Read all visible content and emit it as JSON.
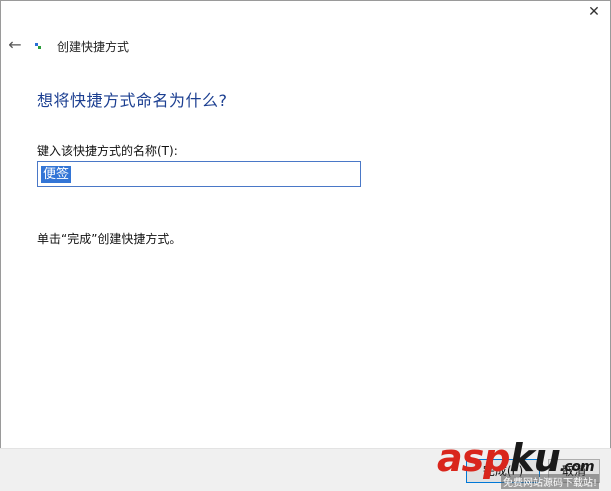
{
  "window": {
    "title": "创建快捷方式",
    "close_glyph": "✕",
    "back_glyph": "←"
  },
  "main": {
    "heading": "想将快捷方式命名为什么?",
    "field_label": "键入该快捷方式的名称(T):",
    "name_value": "便签",
    "hint": "单击“完成”创建快捷方式。"
  },
  "footer": {
    "finish_label": "完成(F)",
    "cancel_label": "取消"
  },
  "watermark": {
    "text_red": "asp",
    "text_black": "ku",
    "text_tail": ".com",
    "subtitle": "免费网站源码下载站!"
  },
  "colors": {
    "heading": "#1c3f91",
    "selection": "#3375d6",
    "input_border": "#4a78c7"
  }
}
